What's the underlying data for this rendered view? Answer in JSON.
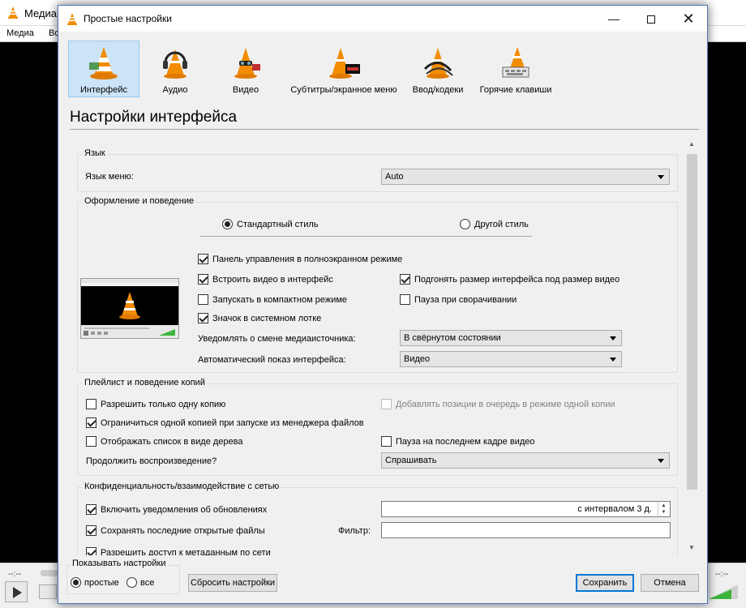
{
  "background_window": {
    "title": "Медиап",
    "menu": [
      "Медиа",
      "Во"
    ],
    "time_left": "--:--",
    "time_right": "--:--"
  },
  "dialog": {
    "title": "Простые настройки",
    "window_controls": {
      "minimize": "—",
      "close": "✕"
    }
  },
  "categories": [
    {
      "label": "Интерфейс",
      "selected": true
    },
    {
      "label": "Аудио",
      "selected": false
    },
    {
      "label": "Видео",
      "selected": false
    },
    {
      "label": "Субтитры/экранное меню",
      "selected": false
    },
    {
      "label": "Ввод/кодеки",
      "selected": false
    },
    {
      "label": "Горячие клавиши",
      "selected": false
    }
  ],
  "section_title": "Настройки интерфейса",
  "language": {
    "group_title": "Язык",
    "menu_language_label": "Язык меню:",
    "menu_language_value": "Auto"
  },
  "look": {
    "group_title": "Оформление и поведение",
    "style_standard": "Стандартный стиль",
    "style_other": "Другой стиль",
    "fullscreen_controls": "Панель управления в полноэкранном режиме",
    "embed_video": "Встроить видео в интерфейс",
    "resize_to_video": "Подгонять размер интерфейса под размер видео",
    "compact_mode": "Запускать в компактном режиме",
    "pause_minimized": "Пауза при сворачивании",
    "systray_icon": "Значок в системном лотке",
    "notify_label": "Уведомлять о смене медиаисточника:",
    "notify_value": "В свёрнутом состоянии",
    "auto_show_label": "Автоматический показ интерфейса:",
    "auto_show_value": "Видео"
  },
  "playlist": {
    "group_title": "Плейлист и поведение копий",
    "one_instance": "Разрешить только одну копию",
    "enqueue_one": "Добавлять позиции в очередь в режиме одной копии",
    "one_instance_fm": "Ограничиться одной копией при запуске из менеджера файлов",
    "tree_view": "Отображать список в виде дерева",
    "pause_last_frame": "Пауза на последнем кадре видео",
    "continue_label": "Продолжить воспроизведение?",
    "continue_value": "Спрашивать"
  },
  "privacy": {
    "group_title": "Конфиденциальность/взаимодействие с сетью",
    "update_notify": "Включить уведомления об обновлениях",
    "update_interval": "с интервалом 3 д.",
    "save_recent": "Сохранять последние открытые файлы",
    "filter_label": "Фильтр:",
    "filter_value": "",
    "metadata_access": "Разрешить доступ к метаданным по сети"
  },
  "show_settings": {
    "group_title": "Показывать настройки",
    "simple": "простые",
    "all": "все"
  },
  "buttons": {
    "reset": "Сбросить настройки",
    "save": "Сохранить",
    "cancel": "Отмена"
  },
  "colors": {
    "accent": "#0078d7",
    "cone_orange": "#f28c00",
    "selected_bg": "#cce4f7"
  }
}
